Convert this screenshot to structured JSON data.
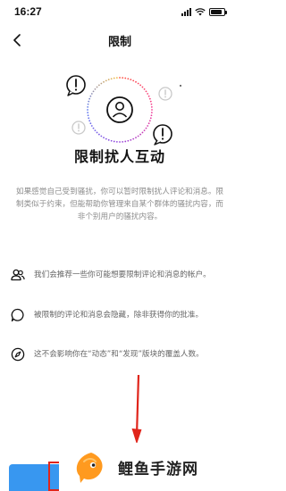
{
  "status_bar": {
    "time": "16:27",
    "battery_level": 0.85
  },
  "nav": {
    "title": "限制",
    "back_icon": "chevron-left-icon"
  },
  "illustration": {
    "center_icon": "user-icon",
    "bubble_icon": "exclamation-bubble-icon"
  },
  "headline": "限制扰人互动",
  "description": "如果感觉自己受到骚扰，你可以暂时限制扰人评论和消息。限制类似于约束，但能帮助你管理来自某个群体的骚扰内容，而非个别用户的骚扰内容。",
  "features": [
    {
      "icon": "users-icon",
      "text": "我们会推荐一些你可能想要限制评论和消息的帐户。"
    },
    {
      "icon": "chat-bubble-icon",
      "text": "被限制的评论和消息会隐藏，除非获得你的批准。"
    },
    {
      "icon": "compass-icon",
      "text": "这不会影响你在“动态”和“发现”版块的覆盖人数。"
    }
  ],
  "watermark": {
    "text": "鲤鱼手游网",
    "icon": "fish-logo-icon"
  },
  "colors": {
    "accent": "#3897f0",
    "annotation_red": "#e0251b",
    "muted_text": "#8e8e8e"
  }
}
